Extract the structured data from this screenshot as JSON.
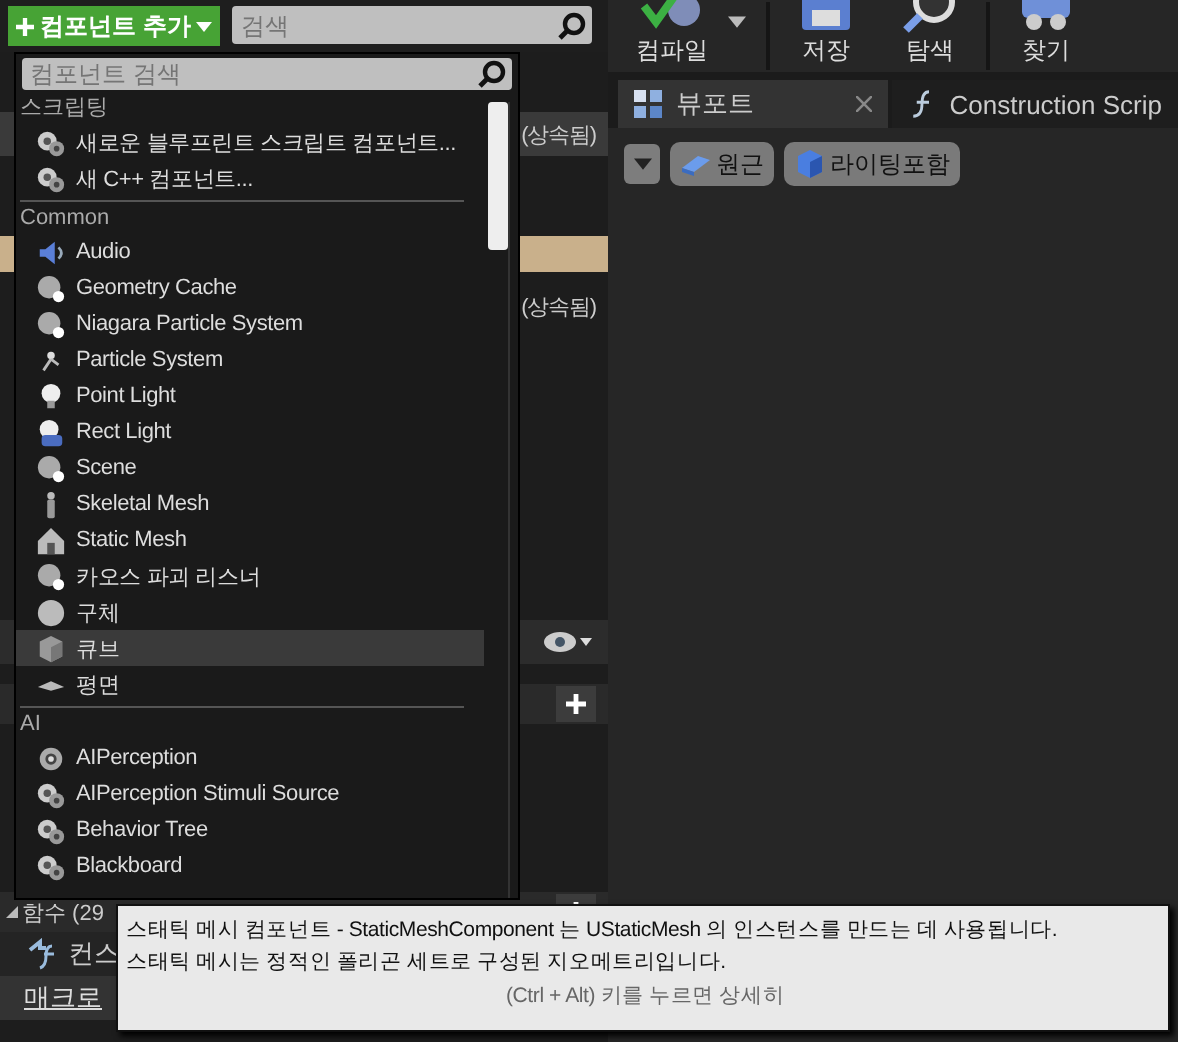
{
  "add_button": {
    "label": "컴포넌트 추가"
  },
  "search": {
    "placeholder": "검색"
  },
  "left_panel": {
    "inherited_labels": [
      "(상속됨)",
      "(상속됨)"
    ],
    "functions_header": "함수 (29",
    "functions_expanded": true,
    "construction_item": "컨스",
    "macros_header": "매크로"
  },
  "component_menu": {
    "search_placeholder": "컴포넌트 검색",
    "groups": [
      {
        "title": "스크립팅",
        "items": [
          {
            "label": "새로운 블루프린트 스크립트 컴포넌트...",
            "kind": "gears",
            "selected": false
          },
          {
            "label": "새 C++ 컴포넌트...",
            "kind": "gears",
            "selected": false
          }
        ]
      },
      {
        "title": "Common",
        "items": [
          {
            "label": "Audio",
            "kind": "speaker",
            "selected": false
          },
          {
            "label": "Geometry Cache",
            "kind": "orb",
            "selected": false
          },
          {
            "label": "Niagara Particle System",
            "kind": "orb",
            "selected": false
          },
          {
            "label": "Particle System",
            "kind": "particle",
            "selected": false
          },
          {
            "label": "Point Light",
            "kind": "bulb",
            "selected": false
          },
          {
            "label": "Rect Light",
            "kind": "rectlight",
            "selected": false
          },
          {
            "label": "Scene",
            "kind": "orb",
            "selected": false
          },
          {
            "label": "Skeletal Mesh",
            "kind": "figure",
            "selected": false
          },
          {
            "label": "Static Mesh",
            "kind": "house",
            "selected": false
          },
          {
            "label": "카오스 파괴 리스너",
            "kind": "orb",
            "selected": false
          },
          {
            "label": "구체",
            "kind": "sphere",
            "selected": false
          },
          {
            "label": "큐브",
            "kind": "cube",
            "selected": true
          },
          {
            "label": "평면",
            "kind": "plane",
            "selected": false
          }
        ]
      },
      {
        "title": "AI",
        "items": [
          {
            "label": "AIPerception",
            "kind": "target",
            "selected": false
          },
          {
            "label": "AIPerception Stimuli Source",
            "kind": "gears",
            "selected": false
          },
          {
            "label": "Behavior Tree",
            "kind": "gears",
            "selected": false
          },
          {
            "label": "Blackboard",
            "kind": "gears",
            "selected": false
          }
        ]
      }
    ]
  },
  "toolbar": [
    {
      "label": "컴파일",
      "kind": "compile"
    },
    {
      "label": "저장",
      "kind": "save"
    },
    {
      "label": "탐색",
      "kind": "browse"
    },
    {
      "label": "찾기",
      "kind": "find"
    }
  ],
  "tabs": [
    {
      "label": "뷰포트",
      "selected": true,
      "closable": true,
      "kind": "viewport"
    },
    {
      "label": "Construction Scrip",
      "selected": false,
      "closable": false,
      "kind": "function"
    }
  ],
  "viewport_buttons": [
    {
      "label": "원근",
      "kind": "perspective"
    },
    {
      "label": "라이팅포함",
      "kind": "lit"
    }
  ],
  "tooltip": {
    "lines": [
      "스태틱 메시 컴포넌트 - StaticMeshComponent 는 UStaticMesh 의 인스턴스를 만드는 데 사용됩니다.",
      "스태틱 메시는 정적인 폴리곤 세트로 구성된 지오메트리입니다."
    ],
    "hint": "(Ctrl + Alt) 키를 누르면 상세히"
  }
}
